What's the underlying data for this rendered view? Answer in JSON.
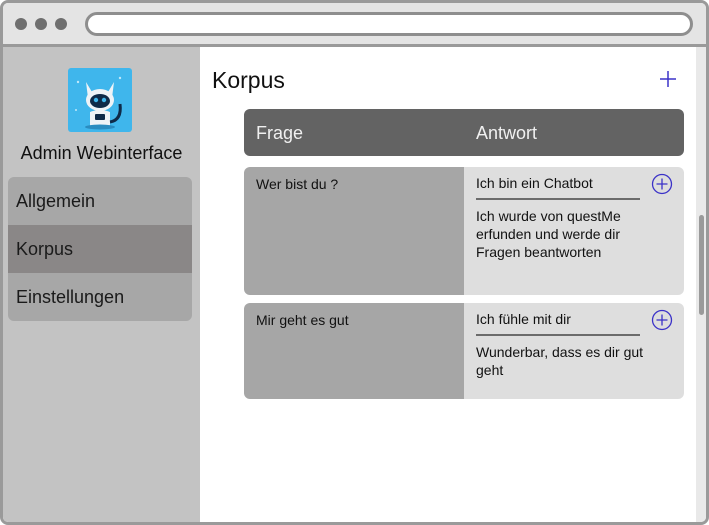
{
  "sidebar": {
    "app_title": "Admin Webinterface",
    "logo_icon": "cat-robot-logo",
    "nav": [
      "Allgemein",
      "Korpus",
      "Einstellungen"
    ],
    "active": "Korpus"
  },
  "main": {
    "title": "Korpus",
    "columns": [
      "Frage",
      "Antwort"
    ],
    "rows": [
      {
        "question": "Wer bist du ?",
        "answer": "Ich bin ein Chatbot",
        "alternative": "Ich wurde von questMe erfunden und werde dir Fragen beantworten"
      },
      {
        "question": "Mir geht es gut",
        "answer": "Ich fühle mit dir",
        "alternative": "Wunderbar, dass es dir gut geht"
      }
    ]
  },
  "colors": {
    "accent": "#3b32c8",
    "header_bg": "#636363",
    "active_nav": "#8a8787"
  }
}
